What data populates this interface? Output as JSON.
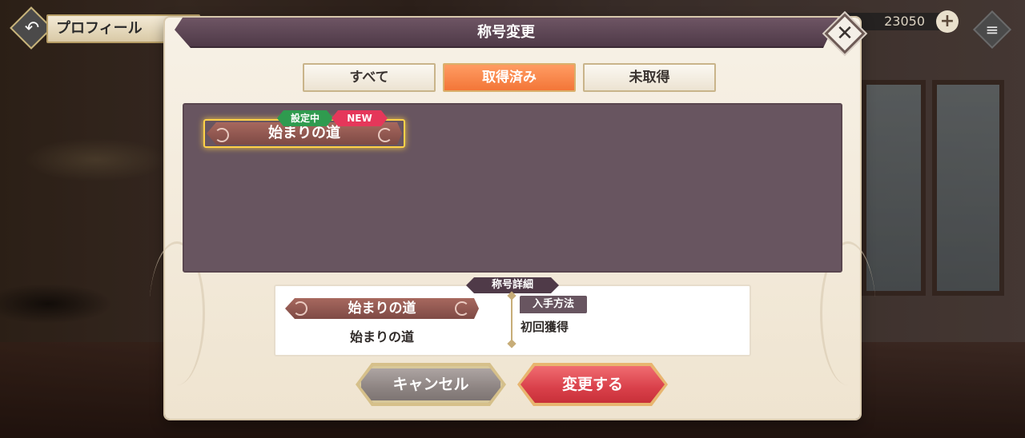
{
  "hud": {
    "back_label": "プロフィール",
    "currency_value": "23050"
  },
  "modal": {
    "title": "称号変更",
    "tabs": [
      {
        "label": "すべて",
        "active": false
      },
      {
        "label": "取得済み",
        "active": true
      },
      {
        "label": "未取得",
        "active": false
      }
    ],
    "list": {
      "items": [
        {
          "name": "始まりの道",
          "badge_set": "設定中",
          "badge_new": "NEW",
          "selected": true
        }
      ]
    },
    "detail": {
      "header": "称号詳細",
      "chip_name": "始まりの道",
      "name": "始まりの道",
      "method_label": "入手方法",
      "method_value": "初回獲得"
    },
    "buttons": {
      "cancel": "キャンセル",
      "confirm": "変更する"
    }
  },
  "colors": {
    "accent_tab": "#f37638",
    "title_bar": "#4f3a48",
    "list_bg": "#685560",
    "confirm_button": "#d9404a",
    "badge_set": "#2f9b4f",
    "badge_new": "#e5375a",
    "selected_glow": "#ffd248"
  },
  "icons": {
    "back": "back-arrow-icon",
    "currency_add": "plus-icon",
    "menu": "hamburger-menu-icon",
    "close": "close-icon"
  }
}
